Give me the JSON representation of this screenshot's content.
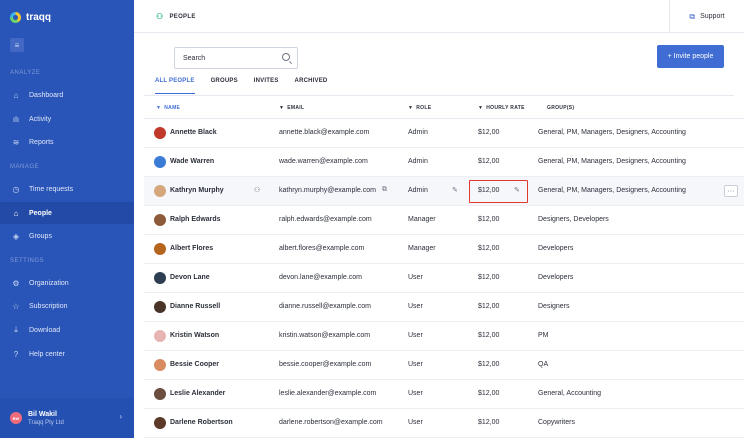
{
  "app": {
    "name": "traqq"
  },
  "sidebar": {
    "sections": {
      "analyze": "ANALYZE",
      "manage": "MANAGE",
      "settings": "SETTINGS"
    },
    "items": [
      {
        "label": "Dashboard",
        "icon": "home-icon"
      },
      {
        "label": "Activity",
        "icon": "bar-chart-icon"
      },
      {
        "label": "Reports",
        "icon": "reports-icon"
      },
      {
        "label": "Time requests",
        "icon": "clock-icon"
      },
      {
        "label": "People",
        "icon": "people-icon",
        "active": true
      },
      {
        "label": "Groups",
        "icon": "layers-icon"
      },
      {
        "label": "Organization",
        "icon": "settings-icon"
      },
      {
        "label": "Subscription",
        "icon": "star-icon"
      },
      {
        "label": "Download",
        "icon": "download-icon"
      },
      {
        "label": "Help center",
        "icon": "help-icon"
      }
    ],
    "user": {
      "initials": "BW",
      "name": "Bil Wakil",
      "org": "Traqq Pty Ltd"
    }
  },
  "header": {
    "title": "PEOPLE",
    "support_label": "Support"
  },
  "search": {
    "value": "Search"
  },
  "invite_button": "+ Invite people",
  "tabs": [
    "ALL PEOPLE",
    "GROUPS",
    "INVITES",
    "ARCHIVED"
  ],
  "table": {
    "columns": [
      "NAME",
      "EMAIL",
      "ROLE",
      "HOURLY RATE",
      "GROUP(S)"
    ],
    "rows": [
      {
        "name": "Annette Black",
        "email": "annette.black@example.com",
        "role": "Admin",
        "rate": "$12,00",
        "groups": "General, PM, Managers, Designers, Accounting"
      },
      {
        "name": "Wade Warren",
        "email": "wade.warren@example.com",
        "role": "Admin",
        "rate": "$12,00",
        "groups": "General, PM, Managers, Designers, Accounting"
      },
      {
        "name": "Kathryn Murphy",
        "email": "kathryn.murphy@example.com",
        "role": "Admin",
        "rate": "$12,00",
        "groups": "General, PM, Managers, Designers, Accounting"
      },
      {
        "name": "Ralph Edwards",
        "email": "ralph.edwards@example.com",
        "role": "Manager",
        "rate": "$12,00",
        "groups": "Designers, Developers"
      },
      {
        "name": "Albert Flores",
        "email": "albert.flores@example.com",
        "role": "Manager",
        "rate": "$12,00",
        "groups": "Developers"
      },
      {
        "name": "Devon Lane",
        "email": "devon.lane@example.com",
        "role": "User",
        "rate": "$12,00",
        "groups": "Developers"
      },
      {
        "name": "Dianne Russell",
        "email": "dianne.russell@example.com",
        "role": "User",
        "rate": "$12,00",
        "groups": "Designers"
      },
      {
        "name": "Kristin Watson",
        "email": "kristin.watson@example.com",
        "role": "User",
        "rate": "$12,00",
        "groups": "PM"
      },
      {
        "name": "Bessie Cooper",
        "email": "bessie.cooper@example.com",
        "role": "User",
        "rate": "$12,00",
        "groups": "QA"
      },
      {
        "name": "Leslie Alexander",
        "email": "leslie.alexander@example.com",
        "role": "User",
        "rate": "$12,00",
        "groups": "General, Accounting"
      },
      {
        "name": "Darlene Robertson",
        "email": "darlene.robertson@example.com",
        "role": "User",
        "rate": "$12,00",
        "groups": "Copywriters"
      }
    ]
  },
  "colors": {
    "sidebar": "#2a55b8",
    "accent": "#3f6dd3",
    "highlight_border": "#e03a2e"
  }
}
